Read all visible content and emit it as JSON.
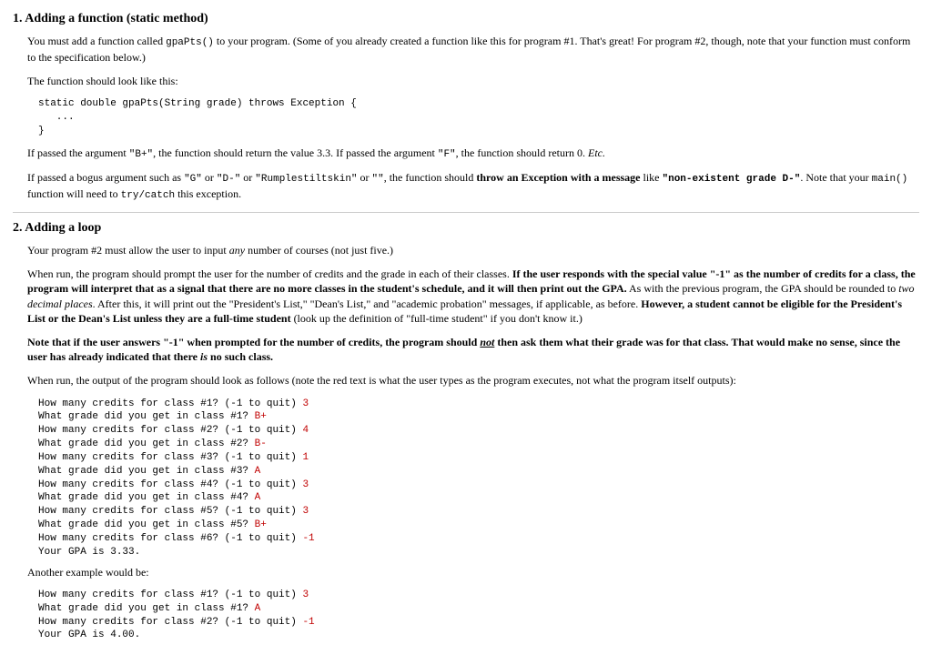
{
  "section1": {
    "title": "1. Adding a function (static method)",
    "p1_a": "You must add a function called ",
    "p1_code": "gpaPts()",
    "p1_b": " to your program. (Some of you already created a function like this for program #1. That's great! For program #2, though, note that your function must conform to the specification below.)",
    "p2": "The function should look like this:",
    "codeblock": "static double gpaPts(String grade) throws Exception {\n   ...\n}",
    "p3_a": "If passed the argument ",
    "p3_q1": "\"B+\"",
    "p3_b": ", the function should return the value 3.3. If passed the argument ",
    "p3_q2": "\"F\"",
    "p3_c": ", the function should return 0. ",
    "p3_etc": "Etc.",
    "p4_a": "If passed a bogus argument such as ",
    "p4_q1": "\"G\"",
    "p4_or1": " or ",
    "p4_q2": "\"D-\"",
    "p4_or2": " or ",
    "p4_q3": "\"Rumplestiltskin\"",
    "p4_or3": " or ",
    "p4_q4": "\"\"",
    "p4_b": ", the function should ",
    "p4_bold": "throw an Exception with a message",
    "p4_c": " like ",
    "p4_msg": "\"non-existent grade D-\"",
    "p4_d": ". Note that your ",
    "p4_main": "main()",
    "p4_e": " function will need to ",
    "p4_try": "try/catch",
    "p4_f": " this exception."
  },
  "section2": {
    "title": "2. Adding a loop",
    "p1_a": "Your program #2 must allow the user to input ",
    "p1_any": "any",
    "p1_b": " number of courses (not just five.)",
    "p2_a": "When run, the program should prompt the user for the number of credits and the grade in each of their classes. ",
    "p2_bold1": "If the user responds with the special value \"-1\" as the number of credits for a class, the program will interpret that as a signal that there are no more classes in the student's schedule, and it will then print out the GPA.",
    "p2_b": " As with the previous program, the GPA should be rounded to ",
    "p2_ital": "two decimal places",
    "p2_c": ". After this, it will print out the \"President's List,\" \"Dean's List,\" and \"academic probation\" messages, if applicable, as before. ",
    "p2_bold2": "However, a student cannot be eligible for the President's List or the Dean's List unless they are a full-time student",
    "p2_d": " (look up the definition of \"full-time student\" if you don't know it.)",
    "p3_bold_a": "Note that if the user answers \"-1\" when prompted for the number of credits, the program should ",
    "p3_bold_not": "not",
    "p3_bold_b": " then ask them what their grade was for that class. That would make no sense, since the user has already indicated that there ",
    "p3_bold_is": "is",
    "p3_bold_c": " no such class.",
    "p4_a": "When run, the output of the program should look as follows (note the red text is what the user types as the program executes, not what the program itself outputs):",
    "sample1": [
      {
        "prompt": "How many credits for class #1? (-1 to quit) ",
        "input": "3"
      },
      {
        "prompt": "What grade did you get in class #1? ",
        "input": "B+"
      },
      {
        "prompt": "How many credits for class #2? (-1 to quit) ",
        "input": "4"
      },
      {
        "prompt": "What grade did you get in class #2? ",
        "input": "B-"
      },
      {
        "prompt": "How many credits for class #3? (-1 to quit) ",
        "input": "1"
      },
      {
        "prompt": "What grade did you get in class #3? ",
        "input": "A"
      },
      {
        "prompt": "How many credits for class #4? (-1 to quit) ",
        "input": "3"
      },
      {
        "prompt": "What grade did you get in class #4? ",
        "input": "A"
      },
      {
        "prompt": "How many credits for class #5? (-1 to quit) ",
        "input": "3"
      },
      {
        "prompt": "What grade did you get in class #5? ",
        "input": "B+"
      },
      {
        "prompt": "How many credits for class #6? (-1 to quit) ",
        "input": "-1"
      },
      {
        "prompt": "Your GPA is 3.33.",
        "input": ""
      }
    ],
    "another": "Another example would be:",
    "sample2": [
      {
        "prompt": "How many credits for class #1? (-1 to quit) ",
        "input": "3"
      },
      {
        "prompt": "What grade did you get in class #1? ",
        "input": "A"
      },
      {
        "prompt": "How many credits for class #2? (-1 to quit) ",
        "input": "-1"
      },
      {
        "prompt": "Your GPA is 4.00.",
        "input": ""
      }
    ]
  }
}
